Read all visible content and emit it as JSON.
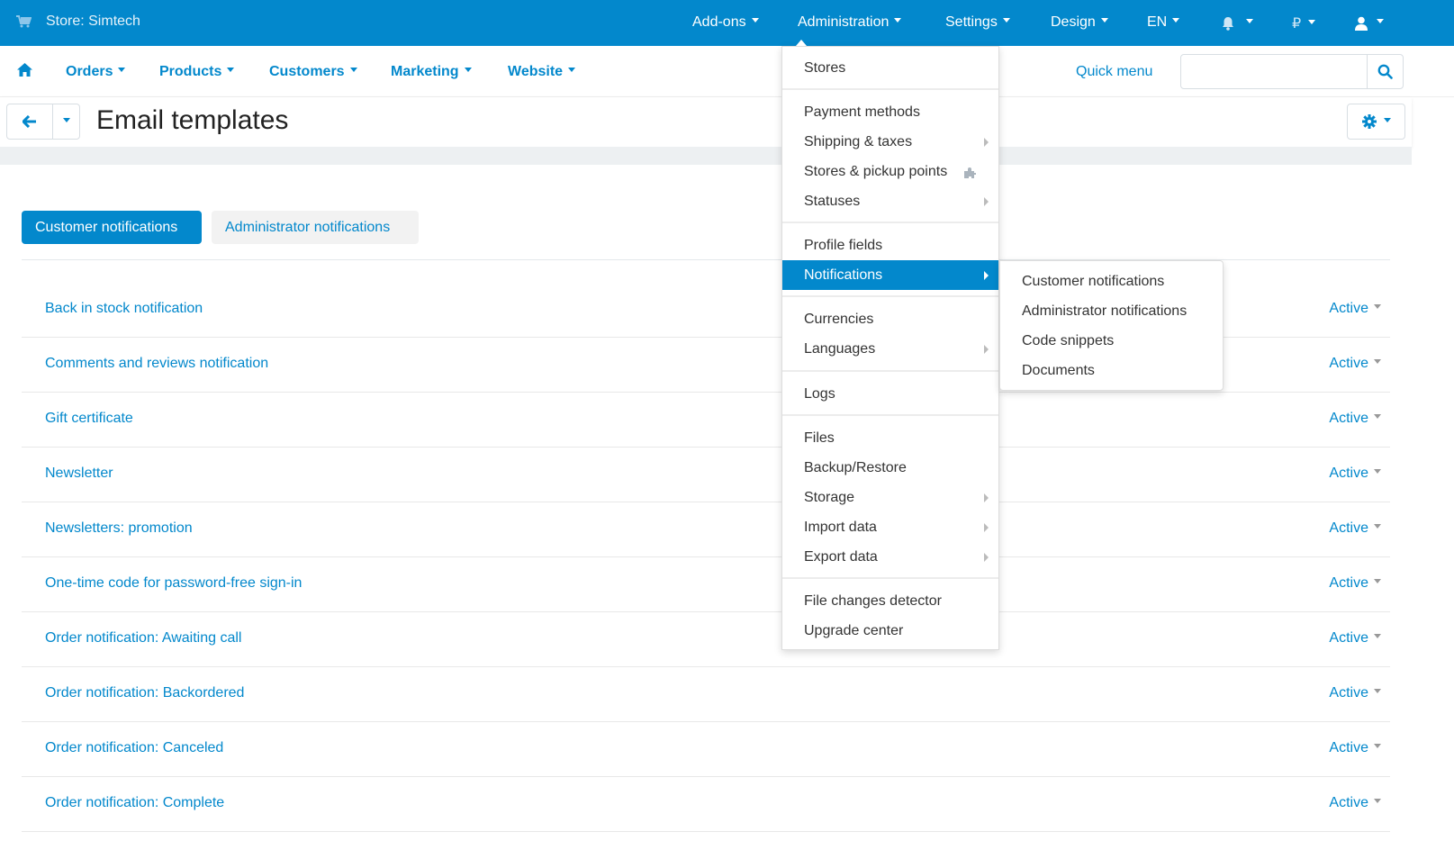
{
  "topbar": {
    "store_label": "Store: Simtech",
    "items": [
      {
        "label": "Add-ons"
      },
      {
        "label": "Administration"
      },
      {
        "label": "Settings"
      },
      {
        "label": "Design"
      },
      {
        "label": "EN"
      },
      {
        "label": "notifications",
        "icon": "bell-icon"
      },
      {
        "label": "₽"
      },
      {
        "label": "account",
        "icon": "user-icon"
      }
    ]
  },
  "subnav": {
    "items": [
      {
        "label": "Orders"
      },
      {
        "label": "Products"
      },
      {
        "label": "Customers"
      },
      {
        "label": "Marketing"
      },
      {
        "label": "Website"
      }
    ],
    "quick_menu": "Quick menu",
    "search_placeholder": ""
  },
  "page": {
    "title": "Email templates"
  },
  "tabs": [
    {
      "label": "Customer notifications",
      "active": true
    },
    {
      "label": "Administrator notifications",
      "active": false
    }
  ],
  "templates": [
    {
      "name": "Back in stock notification",
      "status": "Active"
    },
    {
      "name": "Comments and reviews notification",
      "status": "Active"
    },
    {
      "name": "Gift certificate",
      "status": "Active"
    },
    {
      "name": "Newsletter",
      "status": "Active"
    },
    {
      "name": "Newsletters: promotion",
      "status": "Active"
    },
    {
      "name": "One-time code for password-free sign-in",
      "status": "Active"
    },
    {
      "name": "Order notification: Awaiting call",
      "status": "Active"
    },
    {
      "name": "Order notification: Backordered",
      "status": "Active"
    },
    {
      "name": "Order notification: Canceled",
      "status": "Active"
    },
    {
      "name": "Order notification: Complete",
      "status": "Active"
    }
  ],
  "admin_menu": {
    "items": [
      {
        "label": "Stores"
      },
      {
        "label": "Payment methods"
      },
      {
        "label": "Shipping & taxes",
        "submenu": true
      },
      {
        "label": "Stores & pickup points",
        "addon": true
      },
      {
        "label": "Statuses",
        "submenu": true
      },
      {
        "label": "Profile fields"
      },
      {
        "label": "Notifications",
        "submenu": true,
        "highlighted": true
      },
      {
        "label": "Currencies"
      },
      {
        "label": "Languages",
        "submenu": true
      },
      {
        "label": "Logs"
      },
      {
        "label": "Files"
      },
      {
        "label": "Backup/Restore"
      },
      {
        "label": "Storage",
        "submenu": true
      },
      {
        "label": "Import data",
        "submenu": true
      },
      {
        "label": "Export data",
        "submenu": true
      },
      {
        "label": "File changes detector"
      },
      {
        "label": "Upgrade center"
      }
    ]
  },
  "notifications_submenu": {
    "items": [
      {
        "label": "Customer notifications"
      },
      {
        "label": "Administrator notifications"
      },
      {
        "label": "Code snippets"
      },
      {
        "label": "Documents"
      }
    ]
  },
  "colors": {
    "brand": "#0388cc",
    "page_band": "#edf0f2",
    "tab_inactive": "#f2f2f2"
  }
}
